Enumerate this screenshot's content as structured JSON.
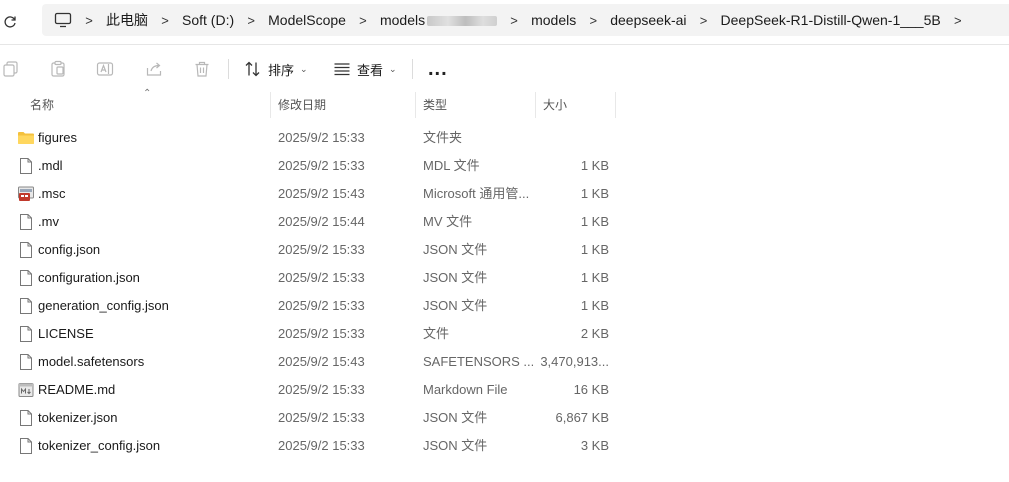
{
  "address_bar": {
    "crumbs": [
      "此电脑",
      "Soft (D:)",
      "ModelScope",
      "models",
      "models",
      "deepseek-ai",
      "DeepSeek-R1-Distill-Qwen-1___5B"
    ]
  },
  "toolbar": {
    "sort_label": "排序",
    "view_label": "查看",
    "more_label": "..."
  },
  "columns": {
    "name": "名称",
    "date": "修改日期",
    "type": "类型",
    "size": "大小"
  },
  "files": [
    {
      "name": "figures",
      "date": "2025/9/2 15:33",
      "type": "文件夹",
      "size": "",
      "icon": "folder-icon"
    },
    {
      "name": ".mdl",
      "date": "2025/9/2 15:33",
      "type": "MDL 文件",
      "size": "1 KB",
      "icon": "file-icon"
    },
    {
      "name": ".msc",
      "date": "2025/9/2 15:43",
      "type": "Microsoft 通用管...",
      "size": "1 KB",
      "icon": "msc-icon"
    },
    {
      "name": ".mv",
      "date": "2025/9/2 15:44",
      "type": "MV 文件",
      "size": "1 KB",
      "icon": "file-icon"
    },
    {
      "name": "config.json",
      "date": "2025/9/2 15:33",
      "type": "JSON 文件",
      "size": "1 KB",
      "icon": "file-icon"
    },
    {
      "name": "configuration.json",
      "date": "2025/9/2 15:33",
      "type": "JSON 文件",
      "size": "1 KB",
      "icon": "file-icon"
    },
    {
      "name": "generation_config.json",
      "date": "2025/9/2 15:33",
      "type": "JSON 文件",
      "size": "1 KB",
      "icon": "file-icon"
    },
    {
      "name": "LICENSE",
      "date": "2025/9/2 15:33",
      "type": "文件",
      "size": "2 KB",
      "icon": "file-icon"
    },
    {
      "name": "model.safetensors",
      "date": "2025/9/2 15:43",
      "type": "SAFETENSORS ...",
      "size": "3,470,913...",
      "icon": "file-icon"
    },
    {
      "name": "README.md",
      "date": "2025/9/2 15:33",
      "type": "Markdown File",
      "size": "16 KB",
      "icon": "markdown-file-icon"
    },
    {
      "name": "tokenizer.json",
      "date": "2025/9/2 15:33",
      "type": "JSON 文件",
      "size": "6,867 KB",
      "icon": "file-icon"
    },
    {
      "name": "tokenizer_config.json",
      "date": "2025/9/2 15:33",
      "type": "JSON 文件",
      "size": "3 KB",
      "icon": "file-icon"
    }
  ],
  "colors": {
    "address_bg": "#f3f3f3",
    "folder": "#f4c13d",
    "msc_red": "#c0392b"
  }
}
